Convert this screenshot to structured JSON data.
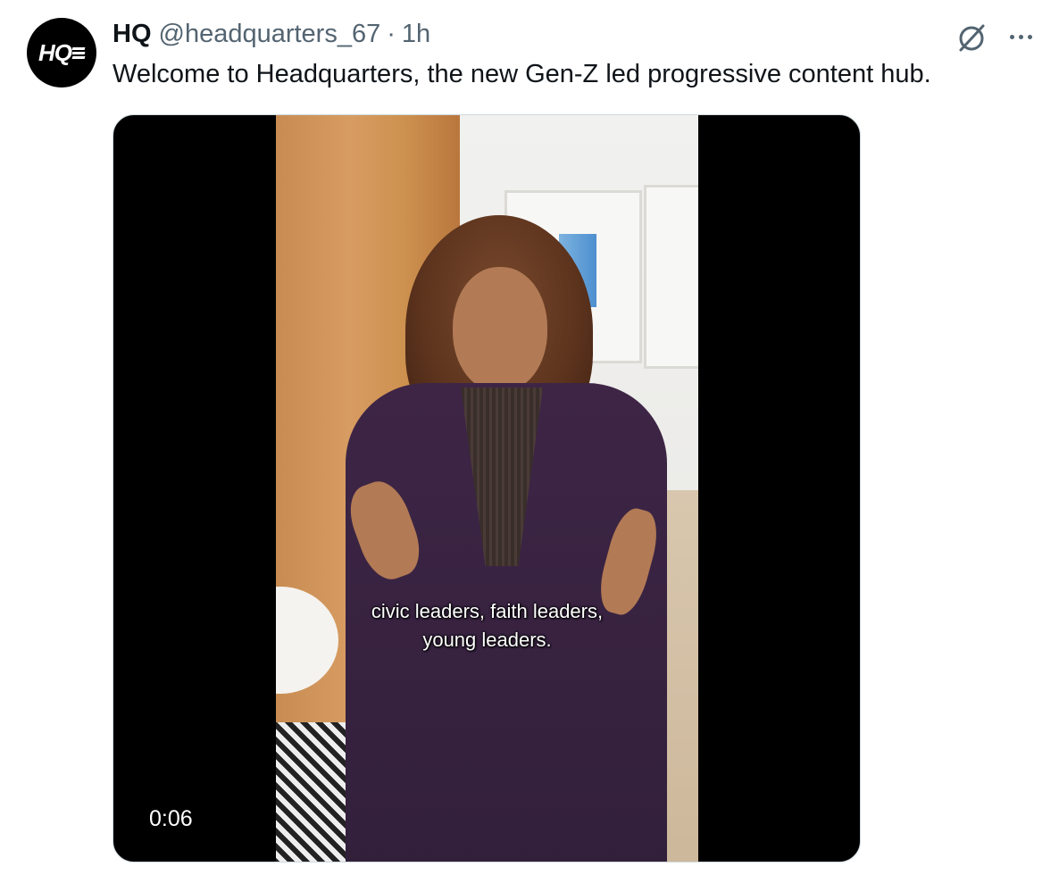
{
  "tweet": {
    "author": {
      "avatar_text": "HQ",
      "name": "HQ",
      "handle": "@headquarters_67",
      "separator": "·",
      "time": "1h"
    },
    "text": "Welcome to Headquarters, the new Gen-Z led progressive content hub.",
    "icons": {
      "grok": "grok-icon",
      "more": "more-icon"
    },
    "media": {
      "type": "video",
      "caption_line1": "civic leaders, faith leaders,",
      "caption_line2": "young leaders.",
      "timestamp": "0:06"
    }
  }
}
